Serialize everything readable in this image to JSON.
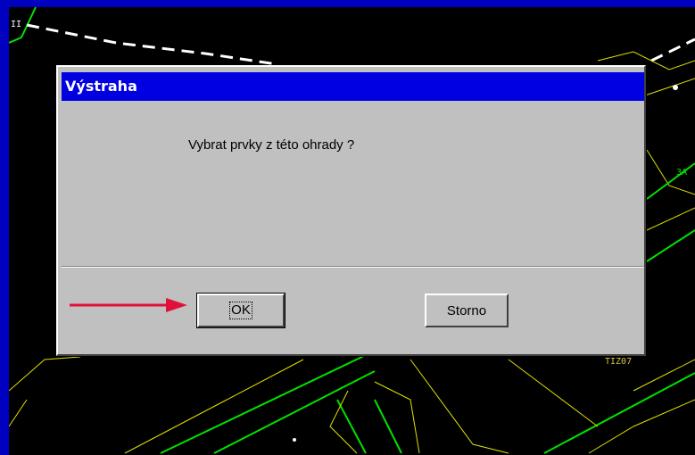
{
  "dialog": {
    "title": "Výstraha",
    "message": "Vybrat prvky z této ohrady ?",
    "ok_label": "OK",
    "cancel_label": "Storno"
  },
  "background": {
    "label_top": "II",
    "label_right": "ЗА",
    "label_bottom": "TIZ07"
  },
  "colors": {
    "frame": "#0000c0",
    "canvas": "#000000",
    "dialog_face": "#c0c0c0",
    "title_bar": "#0000e0",
    "arrow": "#e0103a",
    "map_green": "#00ff00",
    "map_yellow": "#e0e000"
  },
  "annotation": {
    "icon": "red-arrow-icon",
    "points_to": "ok-button"
  }
}
